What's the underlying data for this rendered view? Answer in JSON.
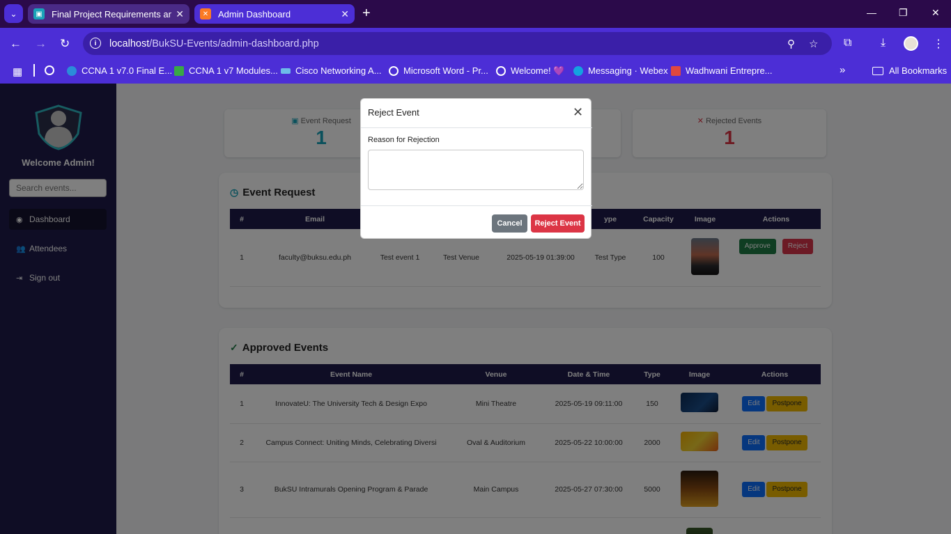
{
  "browser": {
    "tabs": [
      {
        "title": "Final Project Requirements and",
        "active": false
      },
      {
        "title": "Admin Dashboard",
        "active": true
      }
    ],
    "new_tab_label": "+",
    "url_host": "localhost",
    "url_path": "/BukSU-Events/admin-dashboard.php",
    "bookmarks": [
      "CCNA 1 v7.0 Final E...",
      "CCNA 1 v7 Modules...",
      "Cisco Networking A...",
      "Microsoft Word - Pr...",
      "Welcome! 💜",
      "Messaging · Webex",
      "Wadhwani Entrepre..."
    ],
    "all_bookmarks_label": "All Bookmarks"
  },
  "sidebar": {
    "welcome": "Welcome Admin!",
    "search_placeholder": "Search events...",
    "items": [
      {
        "label": "Dashboard",
        "icon": "dashboard-icon"
      },
      {
        "label": "Attendees",
        "icon": "users-icon"
      },
      {
        "label": "Sign out",
        "icon": "sign-out-icon"
      }
    ]
  },
  "stats": {
    "event_request": {
      "label": "Event Request",
      "value": "1",
      "color": "#17a2b8"
    },
    "rejected": {
      "label": "Rejected Events",
      "value": "1",
      "color": "#dc3545"
    }
  },
  "event_request": {
    "title": "Event Request",
    "headers": [
      "#",
      "Email",
      "",
      "",
      "",
      "ype",
      "Capacity",
      "Image",
      "Actions"
    ],
    "rows": [
      {
        "num": "1",
        "email": "faculty@buksu.edu.ph",
        "name": "Test event 1",
        "venue": "Test Venue",
        "datetime": "2025-05-19 01:39:00",
        "type": "Test Type",
        "capacity": "100",
        "approve": "Approve",
        "reject": "Reject"
      }
    ]
  },
  "approved_events": {
    "title": "Approved Events",
    "headers": [
      "#",
      "Event Name",
      "Venue",
      "Date & Time",
      "Type",
      "Image",
      "Actions"
    ],
    "rows": [
      {
        "num": "1",
        "name": "InnovateU: The University Tech & Design Expo",
        "venue": "Mini Theatre",
        "datetime": "2025-05-19 09:11:00",
        "type": "150",
        "edit": "Edit",
        "postpone": "Postpone"
      },
      {
        "num": "2",
        "name": "Campus Connect: Uniting Minds, Celebrating Diversi",
        "venue": "Oval & Auditorium",
        "datetime": "2025-05-22 10:00:00",
        "type": "2000",
        "edit": "Edit",
        "postpone": "Postpone"
      },
      {
        "num": "3",
        "name": "BukSU Intramurals Opening Program & Parade",
        "venue": "Main Campus",
        "datetime": "2025-05-27 07:30:00",
        "type": "5000",
        "edit": "Edit",
        "postpone": "Postpone"
      }
    ]
  },
  "modal": {
    "title": "Reject Event",
    "label": "Reason for Rejection",
    "textarea_value": "",
    "cancel": "Cancel",
    "confirm": "Reject Event"
  }
}
